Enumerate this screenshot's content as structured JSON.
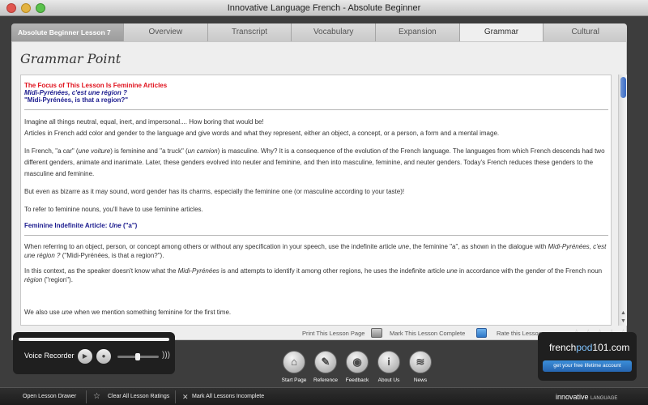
{
  "window": {
    "title": "Innovative Language French - Absolute Beginner"
  },
  "tabs": {
    "lesson": "Absolute Beginner Lesson 7",
    "items": [
      {
        "label": "Overview"
      },
      {
        "label": "Transcript"
      },
      {
        "label": "Vocabulary"
      },
      {
        "label": "Expansion"
      },
      {
        "label": "Grammar"
      },
      {
        "label": "Cultural"
      }
    ],
    "active": "Grammar"
  },
  "panel": {
    "title": "Grammar Point"
  },
  "document": {
    "focus": "The Focus of This Lesson Is Feminine Articles",
    "example_fr": "Midi-Pyrénées, c'est une région ?",
    "example_en": "\"Midi-Pyrénées, is that a region?\"",
    "p1_line1": "Imagine all things neutral, equal, inert, and impersonal.... How boring that would be!",
    "p1_line2": "Articles in French add color and gender to the language and give words and what they represent, either an object, a concept, or a person, a form and a mental image.",
    "p2": {
      "a": "In French, \"a car\" (",
      "b": "une voiture",
      "c": ") is feminine and \"a truck\" (",
      "d": "un camion",
      "e": ") is masculine. Why? It is a consequence of the evolution of the French language. The languages from which French descends had two different genders, animate and inanimate. Later, these genders evolved into neuter and feminine, and then into masculine, feminine, and neuter genders. Today's French reduces these genders to the masculine and feminine."
    },
    "p3": "But even as bizarre as it may sound, word gender has its charms, especially the feminine one (or masculine according to your taste)!",
    "p4": "To refer to feminine nouns, you'll have to use feminine articles.",
    "heading2": {
      "a": "Feminine Indefinite Article: ",
      "b": "Une",
      "c": " (\"a\")"
    },
    "p5": {
      "a": "When referring to an object, person, or concept among others or without any specification in your speech, use the indefinite article ",
      "b": "une",
      "c": ", the feminine \"a\", as shown in the dialogue with ",
      "d": "Midi-Pyrénées, c'est une région ?",
      "e": " (\"Midi-Pyrénées, is that a region?\")."
    },
    "p6": {
      "a": "In this context, as the speaker doesn't know what the ",
      "b": "Midi-Pyrénées",
      "c": " is and attempts to identify it among other regions, he uses the indefinite article ",
      "d": "une",
      "e": " in accordance with the gender of the French noun ",
      "f": "région",
      "g": " (\"region\")."
    },
    "p7": {
      "a": "We also use ",
      "b": "une",
      "c": " when we mention something feminine for the first time."
    }
  },
  "panel_footer": {
    "print": "Print This Lesson Page",
    "complete": "Mark This Lesson Complete",
    "rate": "Rate this Lesson:",
    "stars": "☆☆☆☆☆"
  },
  "recorder": {
    "label": "Voice Recorder"
  },
  "nav": [
    {
      "label": "Start Page",
      "icon": "⌂"
    },
    {
      "label": "Reference",
      "icon": "✎"
    },
    {
      "label": "Feedback",
      "icon": "◉"
    },
    {
      "label": "About Us",
      "icon": "i"
    },
    {
      "label": "News",
      "icon": "≋"
    }
  ],
  "logo": {
    "pre": "french",
    "hi": "pod",
    "post": "101.com",
    "cta": "get your free lifetime account"
  },
  "bottombar": {
    "open_drawer": "Open Lesson Drawer",
    "clear_ratings": "Clear All Lesson Ratings",
    "mark_incomplete": "Mark All Lessons Incomplete",
    "brand": "innovative",
    "brand_small": "LANGUAGE"
  }
}
